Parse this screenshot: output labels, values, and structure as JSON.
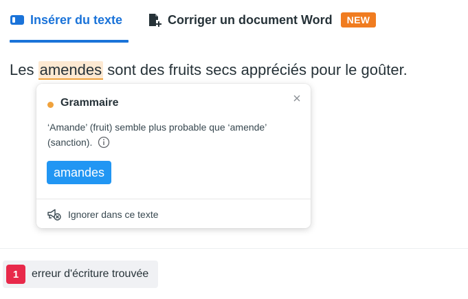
{
  "tabs": {
    "insert_text": {
      "label": "Insérer du texte",
      "icon": "keyboard-icon"
    },
    "correct_word": {
      "label": "Corriger un document Word",
      "icon": "document-add-icon",
      "badge": "NEW"
    }
  },
  "editor": {
    "before": "Les ",
    "error_word": "amendes",
    "after": " sont des fruits secs appréciés pour le goûter."
  },
  "popup": {
    "category": "Grammaire",
    "message": "‘Amande’ (fruit) semble plus probable que ‘amende’ (sanction).",
    "suggestion": "amandes",
    "ignore_label": "Ignorer dans ce texte"
  },
  "status": {
    "count": "1",
    "label": "erreur d'écriture trouvée"
  },
  "colors": {
    "accent": "#1a73d9",
    "new_badge": "#f07c20",
    "error_highlight": "#fde9d2",
    "error_underline": "#f0a23c",
    "suggestion_button": "#2196f3",
    "count_badge": "#e8294a"
  }
}
